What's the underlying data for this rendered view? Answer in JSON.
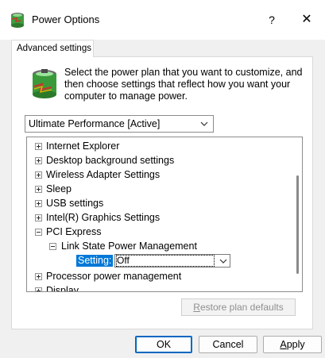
{
  "window": {
    "title": "Power Options",
    "help_label": "?",
    "close_label": "✕"
  },
  "tab": {
    "label": "Advanced settings"
  },
  "instructions": "Select the power plan that you want to customize, and then choose settings that reflect how you want your computer to manage power.",
  "plan_select": {
    "value": "Ultimate Performance [Active]"
  },
  "tree": {
    "items": [
      {
        "label": "Internet Explorer",
        "state": "collapsed"
      },
      {
        "label": "Desktop background settings",
        "state": "collapsed"
      },
      {
        "label": "Wireless Adapter Settings",
        "state": "collapsed"
      },
      {
        "label": "Sleep",
        "state": "collapsed"
      },
      {
        "label": "USB settings",
        "state": "collapsed"
      },
      {
        "label": "Intel(R) Graphics Settings",
        "state": "collapsed"
      },
      {
        "label": "PCI Express",
        "state": "expanded"
      },
      {
        "label": "Link State Power Management",
        "state": "expanded"
      },
      {
        "label": "Processor power management",
        "state": "collapsed"
      },
      {
        "label": "Display",
        "state": "collapsed"
      }
    ],
    "setting": {
      "label": "Setting:",
      "value": "Off"
    }
  },
  "buttons": {
    "restore_accel": "R",
    "restore_rest": "estore plan defaults",
    "ok": "OK",
    "cancel": "Cancel",
    "apply_accel": "A",
    "apply_rest": "pply"
  },
  "colors": {
    "selection": "#0078d7",
    "dialog_bg": "#f0f0f0",
    "ok_border": "#0067c0"
  }
}
